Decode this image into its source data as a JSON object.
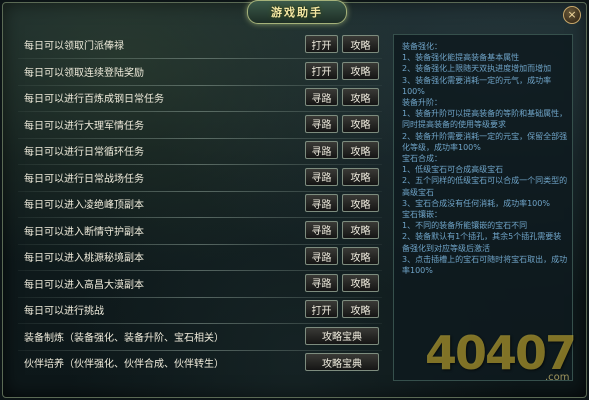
{
  "window": {
    "title": "游戏助手",
    "close_label": "×"
  },
  "rows": [
    {
      "label": "每日可以领取门派俸禄",
      "b1": "打开",
      "b2": "攻略"
    },
    {
      "label": "每日可以领取连续登陆奖励",
      "b1": "打开",
      "b2": "攻略"
    },
    {
      "label": "每日可以进行百炼成钢日常任务",
      "b1": "寻路",
      "b2": "攻略"
    },
    {
      "label": "每日可以进行大理军情任务",
      "b1": "寻路",
      "b2": "攻略"
    },
    {
      "label": "每日可以进行日常循环任务",
      "b1": "寻路",
      "b2": "攻略"
    },
    {
      "label": "每日可以进行日常战场任务",
      "b1": "寻路",
      "b2": "攻略"
    },
    {
      "label": "每日可以进入凌绝峰顶副本",
      "b1": "寻路",
      "b2": "攻略"
    },
    {
      "label": "每日可以进入断情守护副本",
      "b1": "寻路",
      "b2": "攻略"
    },
    {
      "label": "每日可以进入桃源秘境副本",
      "b1": "寻路",
      "b2": "攻略"
    },
    {
      "label": "每日可以进入高昌大漠副本",
      "b1": "寻路",
      "b2": "攻略"
    },
    {
      "label": "每日可以进行挑战",
      "b1": "打开",
      "b2": "攻略"
    },
    {
      "label": "装备制炼（装备强化、装备升阶、宝石相关）",
      "wide": "攻略宝典"
    },
    {
      "label": "伙伴培养（伙伴强化、伙伴合成、伙伴转生）",
      "wide": "攻略宝典"
    }
  ],
  "guide_text": "装备强化：\n1、装备强化能提高装备基本属性\n2、装备强化上限随天双执进度增加而增加\n3、装备强化需要消耗一定的元气，成功率100%\n装备升阶：\n1、装备升阶可以提高装备的等阶和基础属性，同时提高装备的使用等级要求\n2、装备升阶需要消耗一定的元宝，保留全部强化等级，成功率100%\n宝石合成：\n1、低级宝石可合成高级宝石\n2、五个同样的低级宝石可以合成一个同类型的高级宝石\n3、宝石合成没有任何消耗，成功率100%\n宝石镶嵌：\n1、不同的装备所能镶嵌的宝石不同\n2、装备默认有1个插孔，其余5个插孔需要装备强化到对应等级后激活\n3、点击插槽上的宝石可随时将宝石取出，成功率100%",
  "watermark": {
    "digits": "40407",
    "suffix": ".com"
  }
}
